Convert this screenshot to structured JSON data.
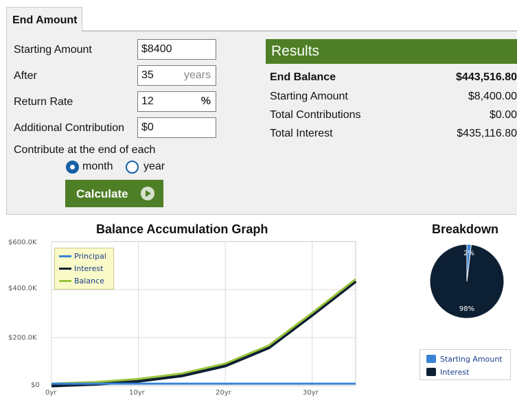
{
  "tab": {
    "label": "End Amount"
  },
  "form": {
    "starting_amount": {
      "label": "Starting Amount",
      "value": "$8400"
    },
    "after": {
      "label": "After",
      "value": "35",
      "unit": "years"
    },
    "return_rate": {
      "label": "Return Rate",
      "value": "12",
      "unit": "%"
    },
    "additional_contribution": {
      "label": "Additional Contribution",
      "value": "$0"
    },
    "contribute_label": "Contribute at the end of each",
    "options": [
      {
        "label": "month",
        "selected": true
      },
      {
        "label": "year",
        "selected": false
      }
    ],
    "calculate_label": "Calculate"
  },
  "results": {
    "header": "Results",
    "rows": [
      {
        "label": "End Balance",
        "value": "$443,516.80"
      },
      {
        "label": "Starting Amount",
        "value": "$8,400.00"
      },
      {
        "label": "Total Contributions",
        "value": "$0.00"
      },
      {
        "label": "Total Interest",
        "value": "$435,116.80"
      }
    ]
  },
  "colors": {
    "accent_green": "#4e7f26",
    "radio_blue": "#1560a5",
    "principal": "#3a82d6",
    "interest": "#0d1f33",
    "balance": "#9ac43c"
  },
  "chart_data": [
    {
      "type": "line",
      "title": "Balance Accumulation Graph",
      "x": [
        0,
        5,
        10,
        15,
        20,
        25,
        30,
        35
      ],
      "x_tick_labels": [
        "0yr",
        "10yr",
        "20yr",
        "30yr"
      ],
      "y_tick_labels": [
        "$0",
        "$200.0K",
        "$400.0K",
        "$600.0K"
      ],
      "ylim": [
        0,
        600000
      ],
      "xlim": [
        0,
        35
      ],
      "grid": true,
      "legend_placement": "top-left",
      "series": [
        {
          "name": "Principal",
          "values": [
            8400,
            8400,
            8400,
            8400,
            8400,
            8400,
            8400,
            8400
          ]
        },
        {
          "name": "Interest",
          "values": [
            0,
            6739,
            19316,
            42141,
            83542,
            158609,
            294700,
            435117
          ]
        },
        {
          "name": "Balance",
          "values": [
            8400,
            15139,
            27716,
            50541,
            91942,
            167009,
            303100,
            443517
          ]
        }
      ]
    },
    {
      "type": "pie",
      "title": "Breakdown",
      "slice_labels": [
        "2%",
        "98%"
      ],
      "series": [
        {
          "name": "Starting Amount",
          "values": [
            8400
          ]
        },
        {
          "name": "Interest",
          "values": [
            435117
          ]
        }
      ]
    }
  ]
}
